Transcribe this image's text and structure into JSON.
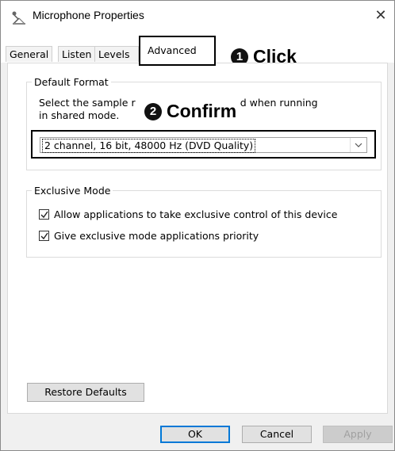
{
  "window": {
    "title": "Microphone Properties",
    "close_glyph": "✕",
    "icon": "microphone-icon"
  },
  "tabs": [
    {
      "label": "General",
      "active": false
    },
    {
      "label": "Listen",
      "active": false
    },
    {
      "label": "Levels",
      "active": false
    },
    {
      "label": "Advanced",
      "active": true
    }
  ],
  "annotations": {
    "click": {
      "number": "1",
      "text": "Click"
    },
    "confirm": {
      "number": "2",
      "text": "Confirm"
    }
  },
  "default_format": {
    "legend": "Default Format",
    "description_line1_start": "Select the sample r",
    "description_line1_end": "used when running",
    "description_line2": "in shared mode.",
    "selected": "2 channel, 16 bit, 48000 Hz (DVD Quality)"
  },
  "exclusive_mode": {
    "legend": "Exclusive Mode",
    "options": [
      {
        "label": "Allow applications to take exclusive control of this device",
        "checked": true
      },
      {
        "label": "Give exclusive mode applications priority",
        "checked": true
      }
    ]
  },
  "buttons": {
    "restore_defaults": "Restore Defaults",
    "ok": "OK",
    "cancel": "Cancel",
    "apply": "Apply"
  },
  "colors": {
    "accent": "#0078d7",
    "annotation_border": "#000000"
  }
}
